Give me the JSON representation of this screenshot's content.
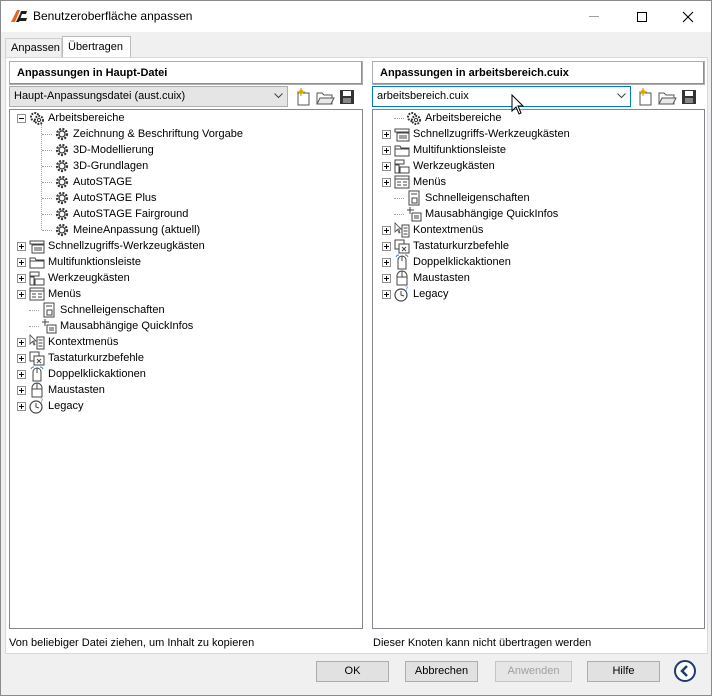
{
  "window": {
    "title": "Benutzeroberfläche anpassen",
    "icon": "autocad-logo-icon"
  },
  "tabs": [
    {
      "label": "Anpassen",
      "active": false
    },
    {
      "label": "Übertragen",
      "active": true
    }
  ],
  "left_panel": {
    "header": "Anpassungen in Haupt-Datei",
    "combo_value": "Haupt-Anpassungsdatei (aust.cuix)",
    "status": "Von beliebiger Datei ziehen, um Inhalt zu kopieren",
    "tree": {
      "root": {
        "label": "Arbeitsbereiche",
        "icon": "gear-stack-icon",
        "expanded": true
      },
      "children": [
        {
          "label": "Zeichnung & Beschriftung Vorgabe",
          "icon": "gear-icon"
        },
        {
          "label": "3D-Modellierung",
          "icon": "gear-icon"
        },
        {
          "label": "3D-Grundlagen",
          "icon": "gear-icon"
        },
        {
          "label": "AutoSTAGE",
          "icon": "gear-icon"
        },
        {
          "label": "AutoSTAGE Plus",
          "icon": "gear-icon"
        },
        {
          "label": "AutoSTAGE Fairground",
          "icon": "gear-icon"
        },
        {
          "label": "MeineAnpassung (aktuell)",
          "icon": "gear-icon"
        }
      ],
      "siblings": [
        {
          "label": "Schnellzugriffs-Werkzeugkästen",
          "icon": "quickaccess-toolbar-icon",
          "expander": true
        },
        {
          "label": "Multifunktionsleiste",
          "icon": "ribbon-folder-icon",
          "expander": true
        },
        {
          "label": "Werkzeugkästen",
          "icon": "toolbars-icon",
          "expander": true
        },
        {
          "label": "Menüs",
          "icon": "menus-icon",
          "expander": true
        },
        {
          "label": "Schnelleigenschaften",
          "icon": "quick-properties-icon",
          "expander": false
        },
        {
          "label": "Mausabhängige QuickInfos",
          "icon": "rollover-tooltip-icon",
          "expander": false
        },
        {
          "label": "Kontextmenüs",
          "icon": "context-menu-icon",
          "expander": true
        },
        {
          "label": "Tastaturkurzbefehle",
          "icon": "keyboard-shortcut-icon",
          "expander": true
        },
        {
          "label": "Doppelklickaktionen",
          "icon": "double-click-icon",
          "expander": true
        },
        {
          "label": "Maustasten",
          "icon": "mouse-buttons-icon",
          "expander": true
        },
        {
          "label": "Legacy",
          "icon": "legacy-clock-icon",
          "expander": true
        }
      ]
    }
  },
  "right_panel": {
    "header": "Anpassungen in arbeitsbereich.cuix",
    "combo_value": "arbeitsbereich.cuix",
    "status": "Dieser Knoten kann nicht übertragen werden",
    "tree": [
      {
        "label": "Arbeitsbereiche",
        "icon": "gear-stack-icon",
        "expander": false
      },
      {
        "label": "Schnellzugriffs-Werkzeugkästen",
        "icon": "quickaccess-toolbar-icon",
        "expander": true
      },
      {
        "label": "Multifunktionsleiste",
        "icon": "ribbon-folder-icon",
        "expander": true
      },
      {
        "label": "Werkzeugkästen",
        "icon": "toolbars-icon",
        "expander": true
      },
      {
        "label": "Menüs",
        "icon": "menus-icon",
        "expander": true
      },
      {
        "label": "Schnelleigenschaften",
        "icon": "quick-properties-icon",
        "expander": false
      },
      {
        "label": "Mausabhängige QuickInfos",
        "icon": "rollover-tooltip-icon",
        "expander": false
      },
      {
        "label": "Kontextmenüs",
        "icon": "context-menu-icon",
        "expander": true
      },
      {
        "label": "Tastaturkurzbefehle",
        "icon": "keyboard-shortcut-icon",
        "expander": true
      },
      {
        "label": "Doppelklickaktionen",
        "icon": "double-click-icon",
        "expander": true
      },
      {
        "label": "Maustasten",
        "icon": "mouse-buttons-icon",
        "expander": true
      },
      {
        "label": "Legacy",
        "icon": "legacy-clock-icon",
        "expander": true
      }
    ]
  },
  "buttons": {
    "ok": "OK",
    "cancel": "Abbrechen",
    "apply": "Anwenden",
    "help": "Hilfe"
  },
  "colors": {
    "focus_border": "#0078d7",
    "disabled_text": "#a0a0a0",
    "logo_orange": "#e8661c"
  }
}
